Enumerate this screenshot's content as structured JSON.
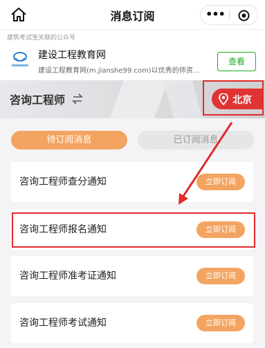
{
  "topbar": {
    "title": "消息订阅",
    "more_label": "•••"
  },
  "account": {
    "tag": "建筑考试宝关联的公众号",
    "name": "建设工程教育网",
    "description": "建设工程教育网(m.jianshe99.com)以优秀的师资...",
    "view_label": "查看"
  },
  "banner": {
    "name": "咨询工程师",
    "location": "北京"
  },
  "tabs": [
    {
      "label": "待订阅消息",
      "active": true
    },
    {
      "label": "已订阅消息",
      "active": false
    }
  ],
  "notifications": [
    {
      "label": "咨询工程师查分通知",
      "button": "立即订阅"
    },
    {
      "label": "咨询工程师报名通知",
      "button": "立即订阅",
      "highlighted": true
    },
    {
      "label": "咨询工程师准考证通知",
      "button": "立即订阅"
    },
    {
      "label": "咨询工程师考试通知",
      "button": "立即订阅"
    }
  ],
  "colors": {
    "accent": "#f3a461",
    "highlight": "#e02a2a",
    "wechat_green": "#1aad19",
    "location_red": "#e03333"
  }
}
